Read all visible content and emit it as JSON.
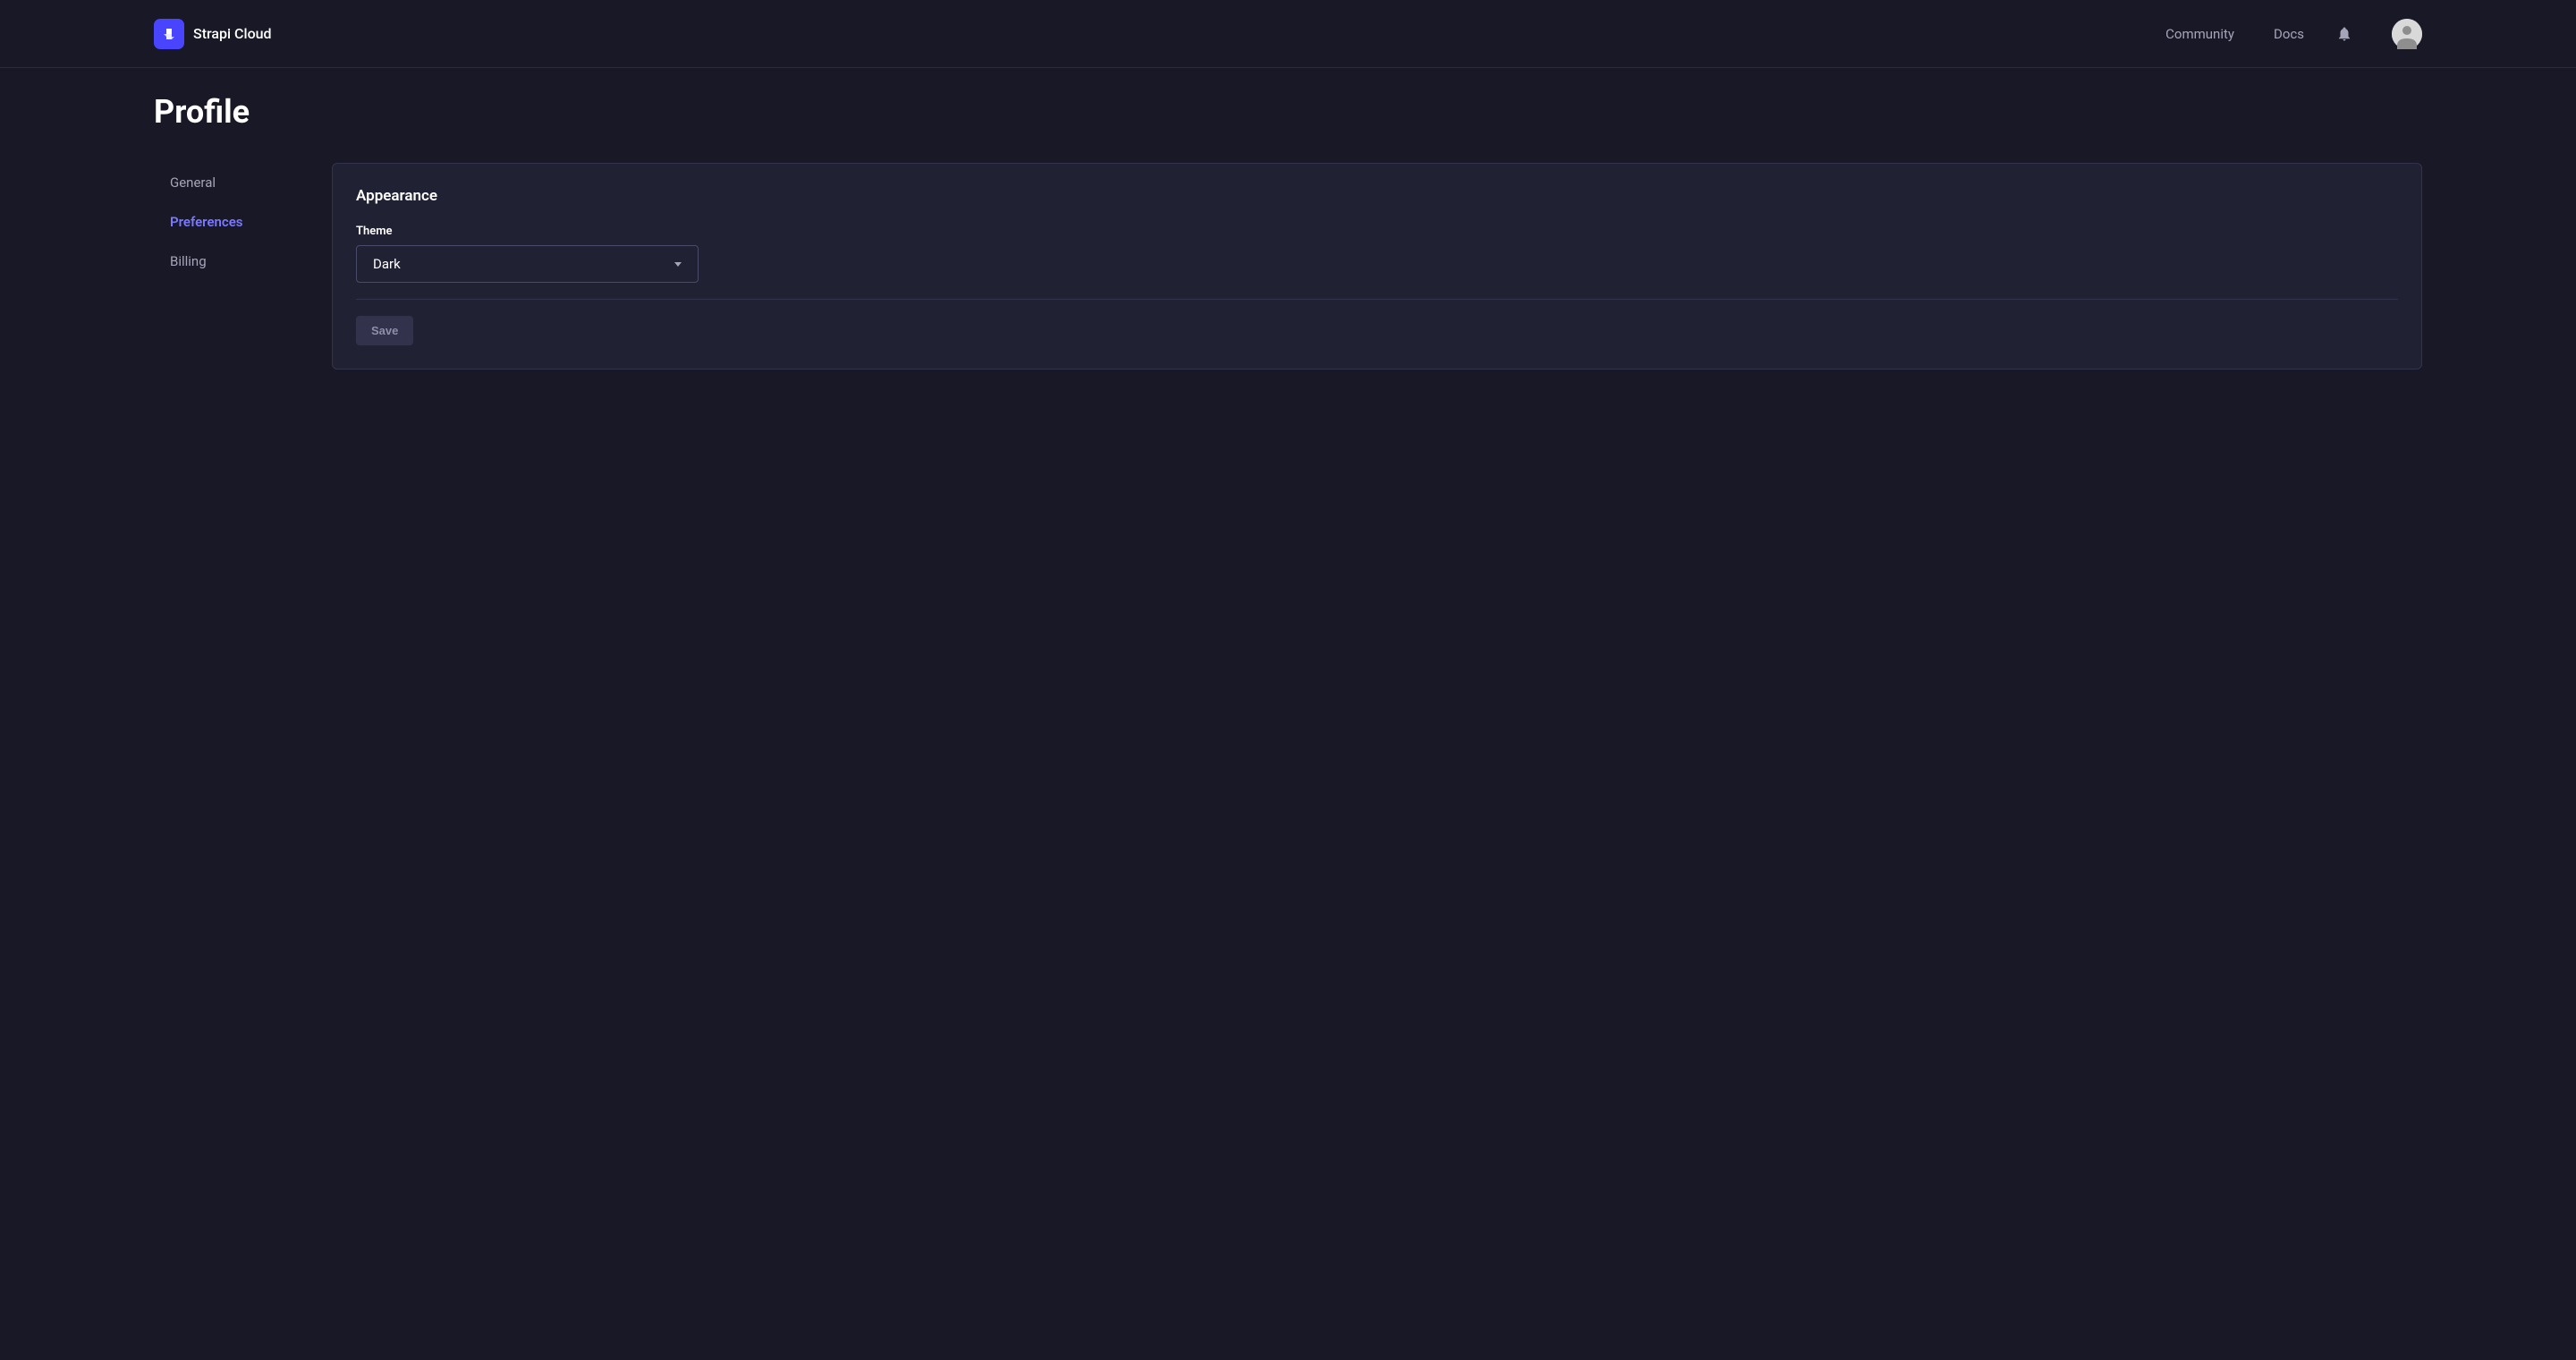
{
  "header": {
    "brand_name": "Strapi Cloud",
    "nav": {
      "community": "Community",
      "docs": "Docs"
    }
  },
  "page": {
    "title": "Profile"
  },
  "sidebar": {
    "items": [
      {
        "label": "General",
        "active": false
      },
      {
        "label": "Preferences",
        "active": true
      },
      {
        "label": "Billing",
        "active": false
      }
    ]
  },
  "panel": {
    "section_title": "Appearance",
    "theme_label": "Theme",
    "theme_value": "Dark",
    "save_label": "Save"
  }
}
